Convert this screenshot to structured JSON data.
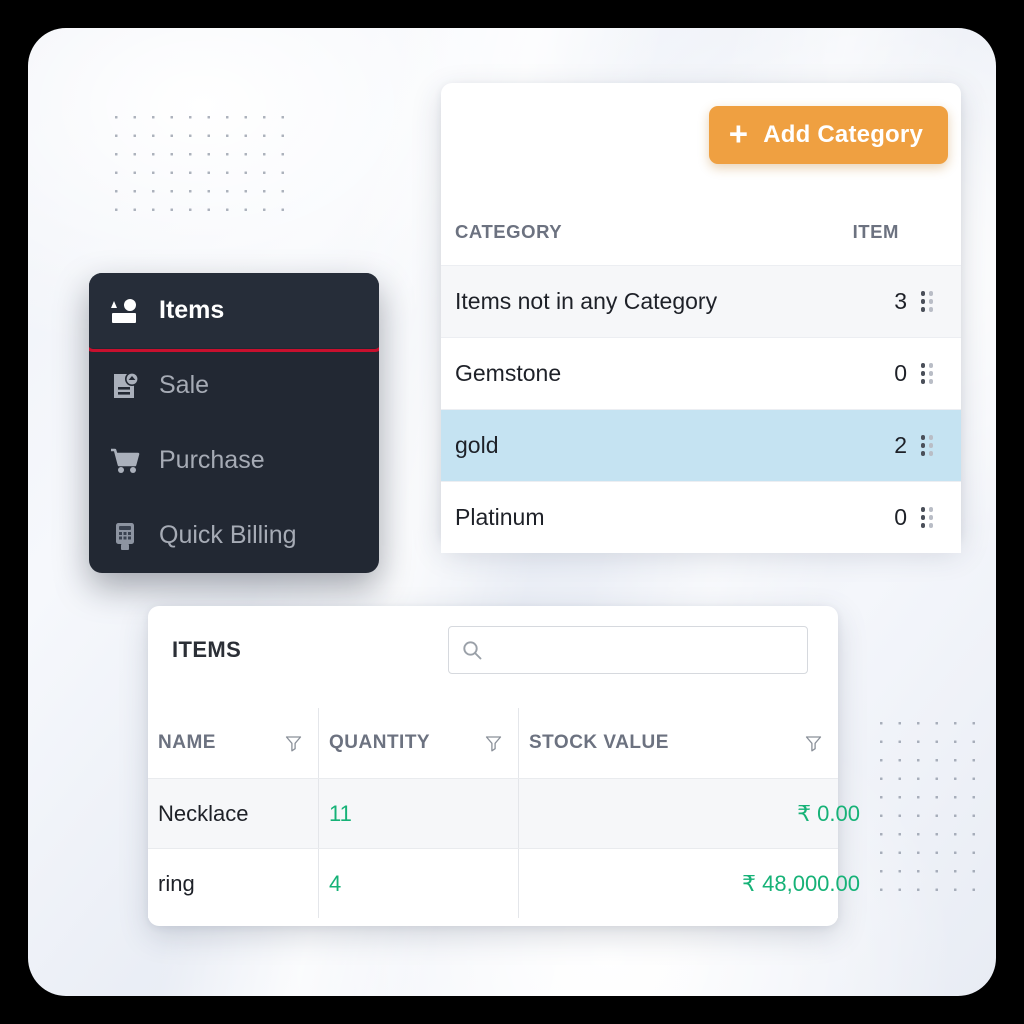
{
  "colors": {
    "accent_orange": "#efa041",
    "highlight_red": "#c8102e",
    "selected_row_blue": "#c5e3f2",
    "money_green": "#16b277",
    "sidebar_dark": "#222833"
  },
  "category_panel": {
    "add_button_label": "Add Category",
    "plus_glyph": "+",
    "columns": [
      "CATEGORY",
      "ITEM"
    ],
    "rows": [
      {
        "name": "Items not in any Category",
        "count": "3",
        "state": "shaded"
      },
      {
        "name": "Gemstone",
        "count": "0",
        "state": "default"
      },
      {
        "name": "gold",
        "count": "2",
        "state": "selected"
      },
      {
        "name": "Platinum",
        "count": "0",
        "state": "default"
      }
    ]
  },
  "sidebar": {
    "items": [
      {
        "label": "Items",
        "icon": "inventory-shapes-icon",
        "active": true
      },
      {
        "label": "Sale",
        "icon": "sale-document-icon",
        "active": false
      },
      {
        "label": "Purchase",
        "icon": "shopping-cart-icon",
        "active": false
      },
      {
        "label": "Quick Billing",
        "icon": "card-terminal-icon",
        "active": false
      }
    ]
  },
  "items_panel": {
    "title": "ITEMS",
    "search": {
      "value": "",
      "placeholder": ""
    },
    "columns": [
      "NAME",
      "QUANTITY",
      "STOCK VALUE"
    ],
    "rows": [
      {
        "name": "Necklace",
        "quantity": "11",
        "stock_value": "₹ 0.00",
        "state": "shaded"
      },
      {
        "name": "ring",
        "quantity": "4",
        "stock_value": "₹ 48,000.00",
        "state": "default"
      }
    ]
  }
}
